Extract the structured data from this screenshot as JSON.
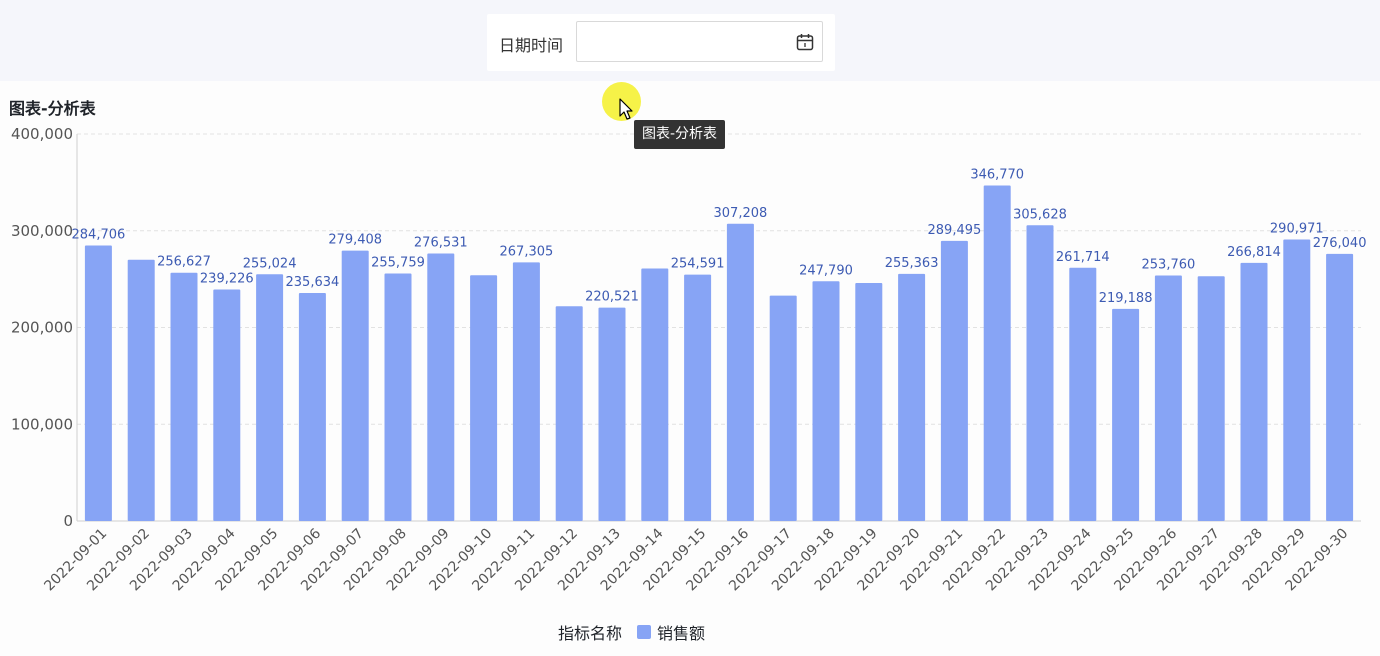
{
  "filter": {
    "label": "日期时间",
    "value": "",
    "placeholder": "",
    "calendar_icon": "calendar-icon"
  },
  "panel": {
    "title": "图表-分析表"
  },
  "tooltip": {
    "text": "图表-分析表"
  },
  "legend": {
    "title": "指标名称",
    "series_name": "销售额"
  },
  "colors": {
    "bar": "#87a4f5",
    "label": "#3d5bb3",
    "axis_text": "#555555",
    "grid": "#e2e2e2",
    "filter_bg": "#f5f6fb"
  },
  "chart_data": {
    "type": "bar",
    "title": "",
    "xlabel": "",
    "ylabel": "",
    "ylim": [
      0,
      400000
    ],
    "y_ticks": [
      "0",
      "100,000",
      "200,000",
      "300,000",
      "400,000"
    ],
    "grid": true,
    "legend_position": "bottom-center",
    "categories": [
      "2022-09-01",
      "2022-09-02",
      "2022-09-03",
      "2022-09-04",
      "2022-09-05",
      "2022-09-06",
      "2022-09-07",
      "2022-09-08",
      "2022-09-09",
      "2022-09-10",
      "2022-09-11",
      "2022-09-12",
      "2022-09-13",
      "2022-09-14",
      "2022-09-15",
      "2022-09-16",
      "2022-09-17",
      "2022-09-18",
      "2022-09-19",
      "2022-09-20",
      "2022-09-21",
      "2022-09-22",
      "2022-09-23",
      "2022-09-24",
      "2022-09-25",
      "2022-09-26",
      "2022-09-27",
      "2022-09-28",
      "2022-09-29",
      "2022-09-30"
    ],
    "series": [
      {
        "name": "销售额",
        "values": [
          284706,
          270000,
          256627,
          239226,
          255024,
          235634,
          279408,
          255759,
          276531,
          254000,
          267305,
          222000,
          220521,
          261000,
          254591,
          307208,
          233000,
          247790,
          246000,
          255363,
          289495,
          346770,
          305628,
          261714,
          219188,
          253760,
          253000,
          266814,
          290971,
          276040
        ],
        "data_labels": [
          "284,706",
          "",
          "256,627",
          "239,226",
          "255,024",
          "235,634",
          "279,408",
          "255,759",
          "276,531",
          "",
          "267,305",
          "",
          "220,521",
          "",
          "254,591",
          "307,208",
          "",
          "247,790",
          "",
          "255,363",
          "289,495",
          "346,770",
          "305,628",
          "261,714",
          "219,188",
          "253,760",
          "",
          "266,814",
          "290,971",
          "276,040"
        ]
      }
    ]
  }
}
